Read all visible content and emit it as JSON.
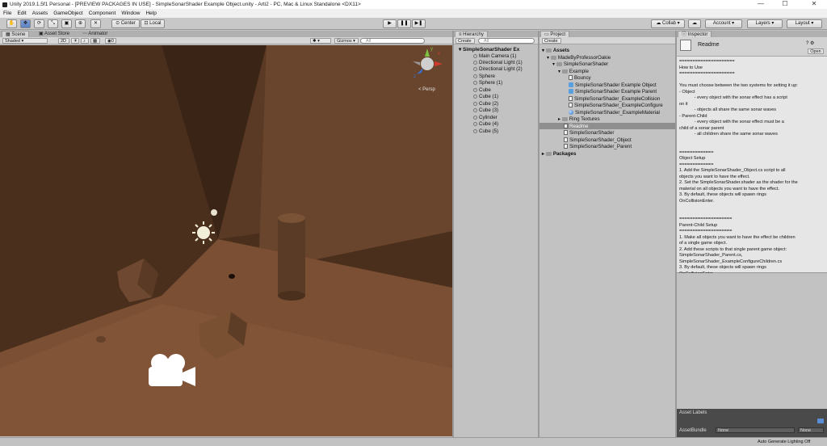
{
  "window": {
    "title": "Unity 2019.1.5f1 Personal - [PREVIEW PACKAGES IN USE] - SimpleSonarShader Example Object.unity - Arti2 - PC, Mac & Linux Standalone <DX11>",
    "minimize": "—",
    "maximize": "☐",
    "close": "✕"
  },
  "menu": [
    "File",
    "Edit",
    "Assets",
    "GameObject",
    "Component",
    "Window",
    "Help"
  ],
  "toolbar": {
    "pivot_label": "Center",
    "space_label": "Local",
    "play": "▶",
    "pause": "❚❚",
    "step": "▶❚",
    "collab_label": "Collab ▾",
    "account_label": "Account",
    "layers_label": "Layers",
    "layout_label": "Layout"
  },
  "scene": {
    "tabs": [
      "Scene",
      "Asset Store",
      "Animator"
    ],
    "shading_mode": "Shaded",
    "mode_2d": "2D",
    "light_count": "0",
    "gizmos_label": "Gizmos ▾",
    "search_placeholder": "All",
    "persp_label": "< Persp",
    "axis_x": "x",
    "axis_y": "y",
    "axis_z": "z"
  },
  "hierarchy": {
    "tab": "Hierarchy",
    "create_label": "Create ▾",
    "search_placeholder": "All",
    "scene_name": "SimpleSonarShader Ex",
    "items": [
      "Main Camera (1)",
      "Directional Light (1)",
      "Directional Light (2)",
      "Sphere",
      "Sphere (1)",
      "Cube",
      "Cube (1)",
      "Cube (2)",
      "Cube (3)",
      "Cylinder",
      "Cube (4)",
      "Cube (5)"
    ]
  },
  "project": {
    "tab": "Project",
    "create_label": "Create ▾",
    "assets_label": "Assets",
    "made_by": "MadeByProfessorOakie",
    "simple_sonar": "SimpleSonarShader",
    "example": "Example",
    "example_items": [
      "Bouncy",
      "SimpleSonarShader Example Object",
      "SimpleSonarShader Example Parent",
      "SimpleSonarShader_ExampleCollision",
      "SimpleSonarShader_ExampleConfigure",
      "SimpleSonarShader_ExampleMaterial"
    ],
    "ring_textures": "Ring Textures",
    "readme": "Readme",
    "files": [
      "SimpleSonarShader",
      "SimpleSonarShader_Object",
      "SimpleSonarShader_Parent"
    ],
    "packages_label": "Packages"
  },
  "inspector": {
    "tab": "Inspector",
    "title": "Readme",
    "open_label": "Open",
    "body_lines": [
      "=====================",
      "How to Use",
      "=====================",
      "",
      "You must choose between the two systems for setting it up:",
      "- Object",
      "            - every object with the sonar effect has a script",
      "on it",
      "            - objects all share the same sonar waves",
      "- Parent-Child",
      "            - every object with the sonar effect must be a",
      "child of a sonar parent",
      "            - all children share the same sonar waves",
      "",
      "",
      "=============",
      "Object Setup",
      "=============",
      "1. Add the SimpleSonarShader_Object.cs script to all",
      "objects you want to have the effect.",
      "2. Set the SimpleSonarShader.shader as the shader for the",
      "material on all objects you want to have the effect.",
      "3. By default, these objects will spawn rings",
      "OnCollisionEnter.",
      "",
      "",
      "====================",
      "Parent-Child Setup",
      "====================",
      "1. Make all objects you want to have the effect be children",
      "of a single game object.",
      "2. Add these scripts to that single parent game object:",
      "SimpleSonarShader_Parent.cs,",
      "SimpleSonarShader_ExampleConfigureChildren.cs",
      "3. By default, these objects will spawn rings",
      "OnCollisionEnter."
    ],
    "asset_labels": "Asset Labels",
    "asset_bundle": "AssetBundle",
    "bundle_value": "None",
    "variant_value": "None"
  },
  "status": {
    "right_text": "Auto Generate Lighting Off"
  }
}
